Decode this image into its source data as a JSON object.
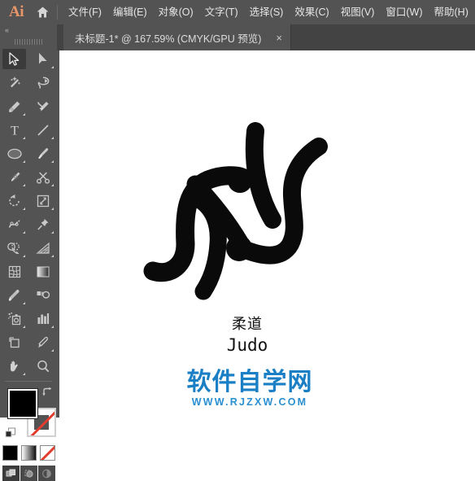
{
  "app": {
    "logo_text": "Ai",
    "home_icon": "home-icon"
  },
  "menubar": {
    "items": [
      {
        "label": "文件(F)",
        "name": "menu-file"
      },
      {
        "label": "编辑(E)",
        "name": "menu-edit"
      },
      {
        "label": "对象(O)",
        "name": "menu-object"
      },
      {
        "label": "文字(T)",
        "name": "menu-type"
      },
      {
        "label": "选择(S)",
        "name": "menu-select"
      },
      {
        "label": "效果(C)",
        "name": "menu-effect"
      },
      {
        "label": "视图(V)",
        "name": "menu-view"
      },
      {
        "label": "窗口(W)",
        "name": "menu-window"
      },
      {
        "label": "帮助(H)",
        "name": "menu-help"
      }
    ]
  },
  "tabbar": {
    "document_tab": {
      "title": "未标题-1* @ 167.59% (CMYK/GPU 预览)",
      "close_label": "×",
      "zoom_level": "167.59%",
      "color_mode": "CMYK",
      "preview_mode": "GPU 预览"
    }
  },
  "toolbar": {
    "collapse_label": "«",
    "tools": [
      {
        "name": "selection-tool",
        "icon": "arrow-cursor-icon",
        "active": true,
        "flyout": false
      },
      {
        "name": "direct-selection-tool",
        "icon": "white-arrow-cursor-icon",
        "active": false,
        "flyout": true
      },
      {
        "name": "magic-wand-tool",
        "icon": "magic-wand-icon",
        "active": false,
        "flyout": false
      },
      {
        "name": "lasso-tool",
        "icon": "lasso-icon",
        "active": false,
        "flyout": false
      },
      {
        "name": "pen-tool",
        "icon": "pen-nib-icon",
        "active": false,
        "flyout": true
      },
      {
        "name": "curvature-tool",
        "icon": "curvature-pen-icon",
        "active": false,
        "flyout": false
      },
      {
        "name": "type-tool",
        "icon": "type-t-icon",
        "active": false,
        "flyout": true
      },
      {
        "name": "line-segment-tool",
        "icon": "line-segment-icon",
        "active": false,
        "flyout": true
      },
      {
        "name": "ellipse-tool",
        "icon": "ellipse-icon",
        "active": false,
        "flyout": true
      },
      {
        "name": "paintbrush-tool",
        "icon": "paintbrush-icon",
        "active": false,
        "flyout": true
      },
      {
        "name": "shaper-pencil-tool",
        "icon": "pencil-icon",
        "active": false,
        "flyout": true
      },
      {
        "name": "scissors-tool",
        "icon": "scissors-icon",
        "active": false,
        "flyout": true
      },
      {
        "name": "rotate-tool",
        "icon": "rotate-icon",
        "active": false,
        "flyout": true
      },
      {
        "name": "scale-tool",
        "icon": "scale-transform-icon",
        "active": false,
        "flyout": true
      },
      {
        "name": "width-tool",
        "icon": "width-warp-icon",
        "active": false,
        "flyout": true
      },
      {
        "name": "free-transform-tool",
        "icon": "pushpin-icon",
        "active": false,
        "flyout": true
      },
      {
        "name": "shape-builder-tool",
        "icon": "shape-builder-icon",
        "active": false,
        "flyout": true
      },
      {
        "name": "perspective-grid-tool",
        "icon": "perspective-grid-icon",
        "active": false,
        "flyout": true
      },
      {
        "name": "mesh-tool",
        "icon": "mesh-icon",
        "active": false,
        "flyout": false
      },
      {
        "name": "gradient-tool",
        "icon": "gradient-icon",
        "active": false,
        "flyout": false
      },
      {
        "name": "eyedropper-tool",
        "icon": "eyedropper-icon",
        "active": false,
        "flyout": true
      },
      {
        "name": "blend-tool",
        "icon": "blend-icon",
        "active": false,
        "flyout": false
      },
      {
        "name": "symbol-sprayer-tool",
        "icon": "symbol-sprayer-icon",
        "active": false,
        "flyout": true
      },
      {
        "name": "column-graph-tool",
        "icon": "bar-chart-icon",
        "active": false,
        "flyout": true
      },
      {
        "name": "artboard-tool",
        "icon": "artboard-icon",
        "active": false,
        "flyout": false
      },
      {
        "name": "slice-tool",
        "icon": "slice-knife-icon",
        "active": false,
        "flyout": true
      },
      {
        "name": "hand-tool",
        "icon": "hand-icon",
        "active": false,
        "flyout": true
      },
      {
        "name": "zoom-tool",
        "icon": "magnifier-icon",
        "active": false,
        "flyout": false
      }
    ],
    "fill_stroke": {
      "fill_color": "#000000",
      "stroke_color": "#ffffff",
      "stroke_is_none": true,
      "swap_icon": "swap-arrow-icon",
      "default_icon": "default-fill-stroke-icon"
    },
    "paint_modes": [
      {
        "name": "color-mode-button",
        "icon": "solid-color-icon"
      },
      {
        "name": "gradient-mode-button",
        "icon": "gradient-swatch-icon"
      },
      {
        "name": "none-mode-button",
        "icon": "none-swatch-icon"
      }
    ],
    "draw_modes": [
      {
        "name": "draw-normal-button",
        "icon": "draw-normal-icon",
        "selected": true
      },
      {
        "name": "draw-behind-button",
        "icon": "draw-behind-icon",
        "selected": false
      },
      {
        "name": "draw-inside-button",
        "icon": "draw-inside-icon",
        "selected": false
      }
    ]
  },
  "canvas": {
    "artwork_name": "judo-calligraphy-artwork",
    "artwork_color": "#0a0a0a",
    "label_cn": "柔道",
    "label_en": "Judo"
  },
  "watermark": {
    "brand_cn": "软件自学网",
    "url": "WWW.RJZXW.COM",
    "color": "#1a7fc4"
  }
}
